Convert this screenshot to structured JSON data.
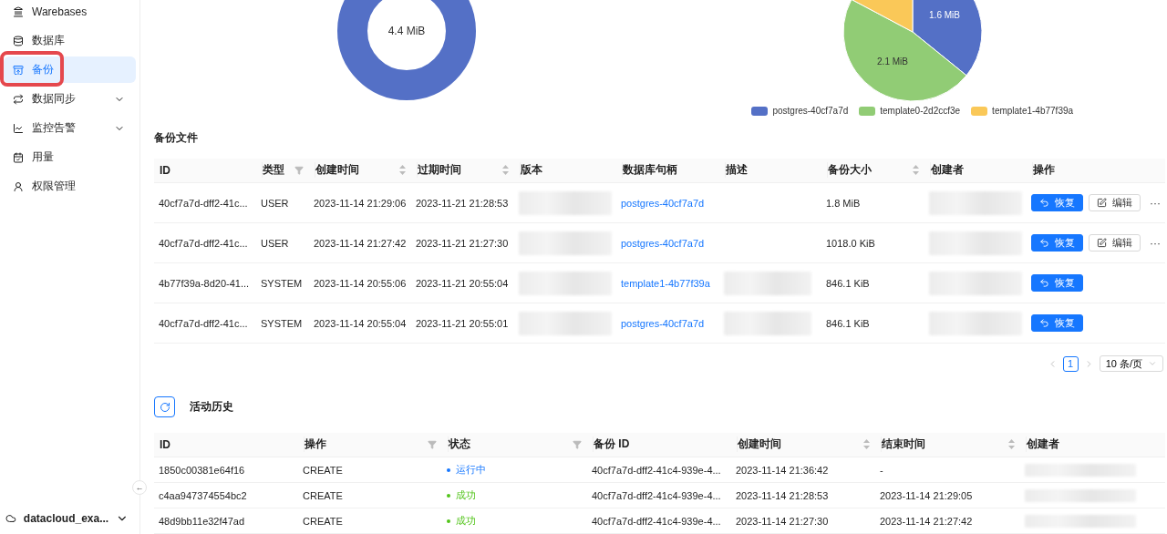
{
  "sidebar": {
    "items": [
      {
        "label": "Warebases",
        "selected": false,
        "expandable": false,
        "highlighted": false
      },
      {
        "label": "数据库",
        "selected": false,
        "expandable": false,
        "highlighted": false
      },
      {
        "label": "备份",
        "selected": true,
        "expandable": false,
        "highlighted": true
      },
      {
        "label": "数据同步",
        "selected": false,
        "expandable": true,
        "highlighted": false
      },
      {
        "label": "监控告警",
        "selected": false,
        "expandable": true,
        "highlighted": false
      },
      {
        "label": "用量",
        "selected": false,
        "expandable": false,
        "highlighted": false
      },
      {
        "label": "权限管理",
        "selected": false,
        "expandable": false,
        "highlighted": false
      }
    ],
    "collapse": "←",
    "workspace": "datacloud_exa..."
  },
  "charts": {
    "donut": {
      "center_label": "4.4 MiB"
    },
    "pie": {
      "slice_labels": [
        "1.6 MiB",
        "2.1 MiB"
      ],
      "legend": [
        {
          "label": "postgres-40cf7a7d",
          "color": "#5470c6"
        },
        {
          "label": "template0-2d2ccf3e",
          "color": "#91cc75"
        },
        {
          "label": "template1-4b77f39a",
          "color": "#fac858"
        }
      ]
    }
  },
  "backups": {
    "title": "备份文件",
    "columns": [
      {
        "label": "ID",
        "kind": "plain"
      },
      {
        "label": "类型",
        "kind": "filter"
      },
      {
        "label": "创建时间",
        "kind": "sort"
      },
      {
        "label": "过期时间",
        "kind": "sort"
      },
      {
        "label": "版本",
        "kind": "plain"
      },
      {
        "label": "数据库句柄",
        "kind": "plain"
      },
      {
        "label": "描述",
        "kind": "plain"
      },
      {
        "label": "备份大小",
        "kind": "sort"
      },
      {
        "label": "创建者",
        "kind": "plain"
      },
      {
        "label": "操作",
        "kind": "plain"
      }
    ],
    "rows": [
      {
        "id": "40cf7a7d-dff2-41c...",
        "type": "USER",
        "created": "2023-11-14 21:29:06",
        "expires": "2023-11-21 21:28:53",
        "version_blurred": true,
        "handle": "postgres-40cf7a7d",
        "description_blurred": false,
        "size": "1.8 MiB",
        "creator_blurred": true,
        "actions": [
          {
            "kind": "primary",
            "label": "恢复"
          },
          {
            "kind": "edit",
            "label": "编辑"
          },
          {
            "kind": "more",
            "label": "···"
          }
        ]
      },
      {
        "id": "40cf7a7d-dff2-41c...",
        "type": "USER",
        "created": "2023-11-14 21:27:42",
        "expires": "2023-11-21 21:27:30",
        "version_blurred": true,
        "handle": "postgres-40cf7a7d",
        "description_blurred": false,
        "size": "1018.0 KiB",
        "creator_blurred": true,
        "actions": [
          {
            "kind": "primary",
            "label": "恢复"
          },
          {
            "kind": "edit",
            "label": "编辑"
          },
          {
            "kind": "more",
            "label": "···"
          }
        ]
      },
      {
        "id": "4b77f39a-8d20-41...",
        "type": "SYSTEM",
        "created": "2023-11-14 20:55:06",
        "expires": "2023-11-21 20:55:04",
        "version_blurred": true,
        "handle": "template1-4b77f39a",
        "description_blurred": true,
        "size": "846.1 KiB",
        "creator_blurred": true,
        "actions": [
          {
            "kind": "primary",
            "label": "恢复"
          }
        ]
      },
      {
        "id": "40cf7a7d-dff2-41c...",
        "type": "SYSTEM",
        "created": "2023-11-14 20:55:04",
        "expires": "2023-11-21 20:55:01",
        "version_blurred": true,
        "handle": "postgres-40cf7a7d",
        "description_blurred": true,
        "size": "846.1 KiB",
        "creator_blurred": true,
        "actions": [
          {
            "kind": "primary",
            "label": "恢复"
          }
        ]
      }
    ],
    "pagination": {
      "pages": [
        {
          "label": "1",
          "selected": true
        }
      ],
      "page_size": "10 条/页"
    }
  },
  "history": {
    "title": "活动历史",
    "columns": [
      {
        "label": "ID",
        "kind": "plain"
      },
      {
        "label": "操作",
        "kind": "filter"
      },
      {
        "label": "状态",
        "kind": "filter"
      },
      {
        "label": "备份 ID",
        "kind": "plain"
      },
      {
        "label": "创建时间",
        "kind": "sort"
      },
      {
        "label": "结束时间",
        "kind": "sort"
      },
      {
        "label": "创建者",
        "kind": "plain"
      }
    ],
    "rows": [
      {
        "id": "1850c00381e64f16",
        "operation": "CREATE",
        "status": {
          "label": "运行中",
          "color": "#1677ff"
        },
        "backup_id": "40cf7a7d-dff2-41c4-939e-4...",
        "created": "2023-11-14 21:36:42",
        "ended": "-",
        "creator_blurred": true
      },
      {
        "id": "c4aa947374554bc2",
        "operation": "CREATE",
        "status": {
          "label": "成功",
          "color": "#52c41a"
        },
        "backup_id": "40cf7a7d-dff2-41c4-939e-4...",
        "created": "2023-11-14 21:28:53",
        "ended": "2023-11-14 21:29:05",
        "creator_blurred": true
      },
      {
        "id": "48d9bb11e32f47ad",
        "operation": "CREATE",
        "status": {
          "label": "成功",
          "color": "#52c41a"
        },
        "backup_id": "40cf7a7d-dff2-41c4-939e-4...",
        "created": "2023-11-14 21:27:30",
        "ended": "2023-11-14 21:27:42",
        "creator_blurred": true
      }
    ]
  }
}
